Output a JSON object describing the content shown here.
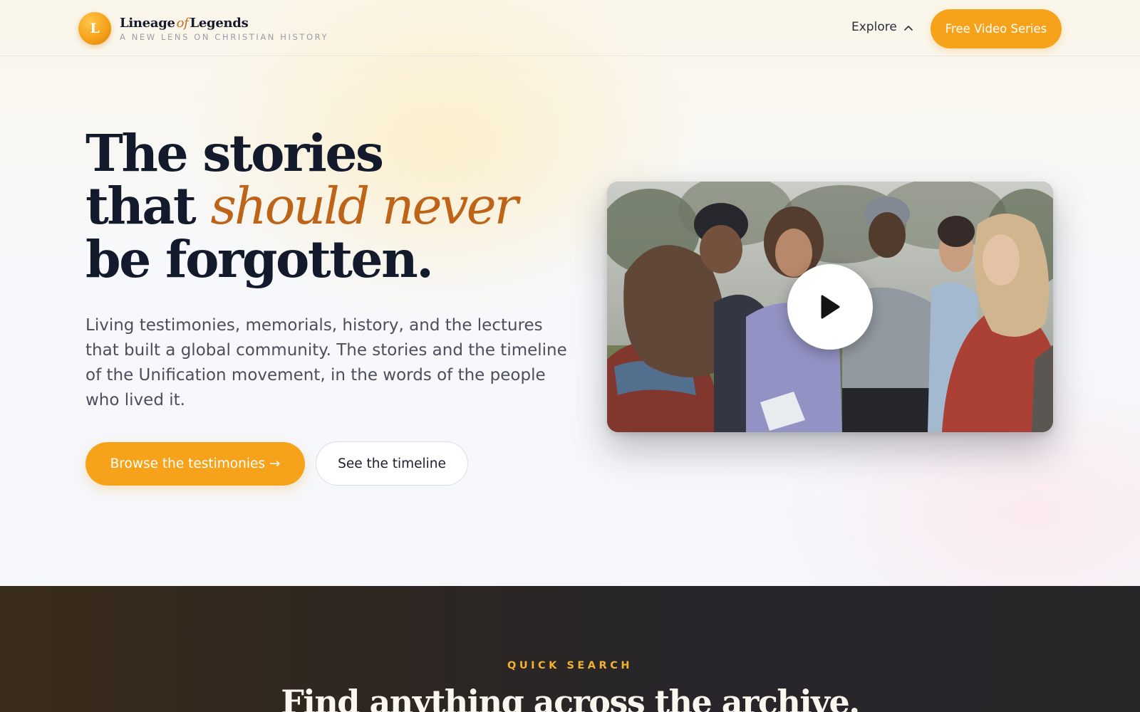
{
  "brand": {
    "logo_letter": "L",
    "name_part1": "Lineage",
    "name_of": "of",
    "name_part2": "Legends",
    "tagline": "A NEW LENS ON CHRISTIAN HISTORY"
  },
  "nav": {
    "explore_label": "Explore",
    "explore_icon": "chevron-up-icon",
    "cta_label": "Free Video Series"
  },
  "hero": {
    "title_line1": "The stories",
    "title_line2_plain": "that ",
    "title_line2_accent": "should never",
    "title_line3": "be forgotten.",
    "description": "Living testimonies, memorials, history, and the lectures that built a global community. The stories and the timeline of the Unification movement, in the words of the people who lived it.",
    "primary_button": "Browse the testimonies →",
    "secondary_button": "See the timeline",
    "accent_color": "#bd6418"
  },
  "video": {
    "play_icon": "play-icon"
  },
  "quick_search": {
    "eyebrow": "QUICK SEARCH",
    "heading": "Find anything across the archive."
  },
  "colors": {
    "brand_orange": "#f6a21a",
    "heading_navy": "#131a2c",
    "dark_section": "#2a2624"
  }
}
